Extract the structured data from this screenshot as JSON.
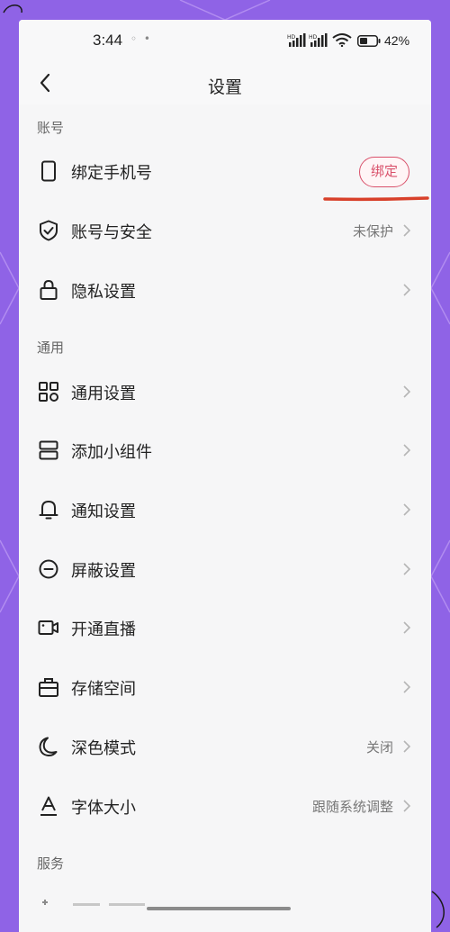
{
  "status_bar": {
    "time": "3:44",
    "dots": "◦ •",
    "signal_hd_1": "HD",
    "signal_hd_2": "HD",
    "battery_pct": "42%"
  },
  "navbar": {
    "title": "设置"
  },
  "sections": [
    {
      "label": "账号"
    },
    {
      "label": "通用"
    },
    {
      "label": "服务"
    }
  ],
  "account_items": [
    {
      "label": "绑定手机号",
      "icon": "phone-icon",
      "button": "绑定"
    },
    {
      "label": "账号与安全",
      "icon": "shield-check-icon",
      "value": "未保护"
    },
    {
      "label": "隐私设置",
      "icon": "lock-icon"
    }
  ],
  "general_items": [
    {
      "label": "通用设置",
      "icon": "grid-icon"
    },
    {
      "label": "添加小组件",
      "icon": "widget-icon"
    },
    {
      "label": "通知设置",
      "icon": "bell-icon"
    },
    {
      "label": "屏蔽设置",
      "icon": "block-icon"
    },
    {
      "label": "开通直播",
      "icon": "live-camera-icon"
    },
    {
      "label": "存储空间",
      "icon": "storage-icon"
    },
    {
      "label": "深色模式",
      "icon": "moon-icon",
      "value": "关闭"
    },
    {
      "label": "字体大小",
      "icon": "font-size-icon",
      "value": "跟随系统调整"
    }
  ],
  "colors": {
    "background": "#8f63e6",
    "accent": "#d9506a",
    "underline": "#d8402a"
  }
}
